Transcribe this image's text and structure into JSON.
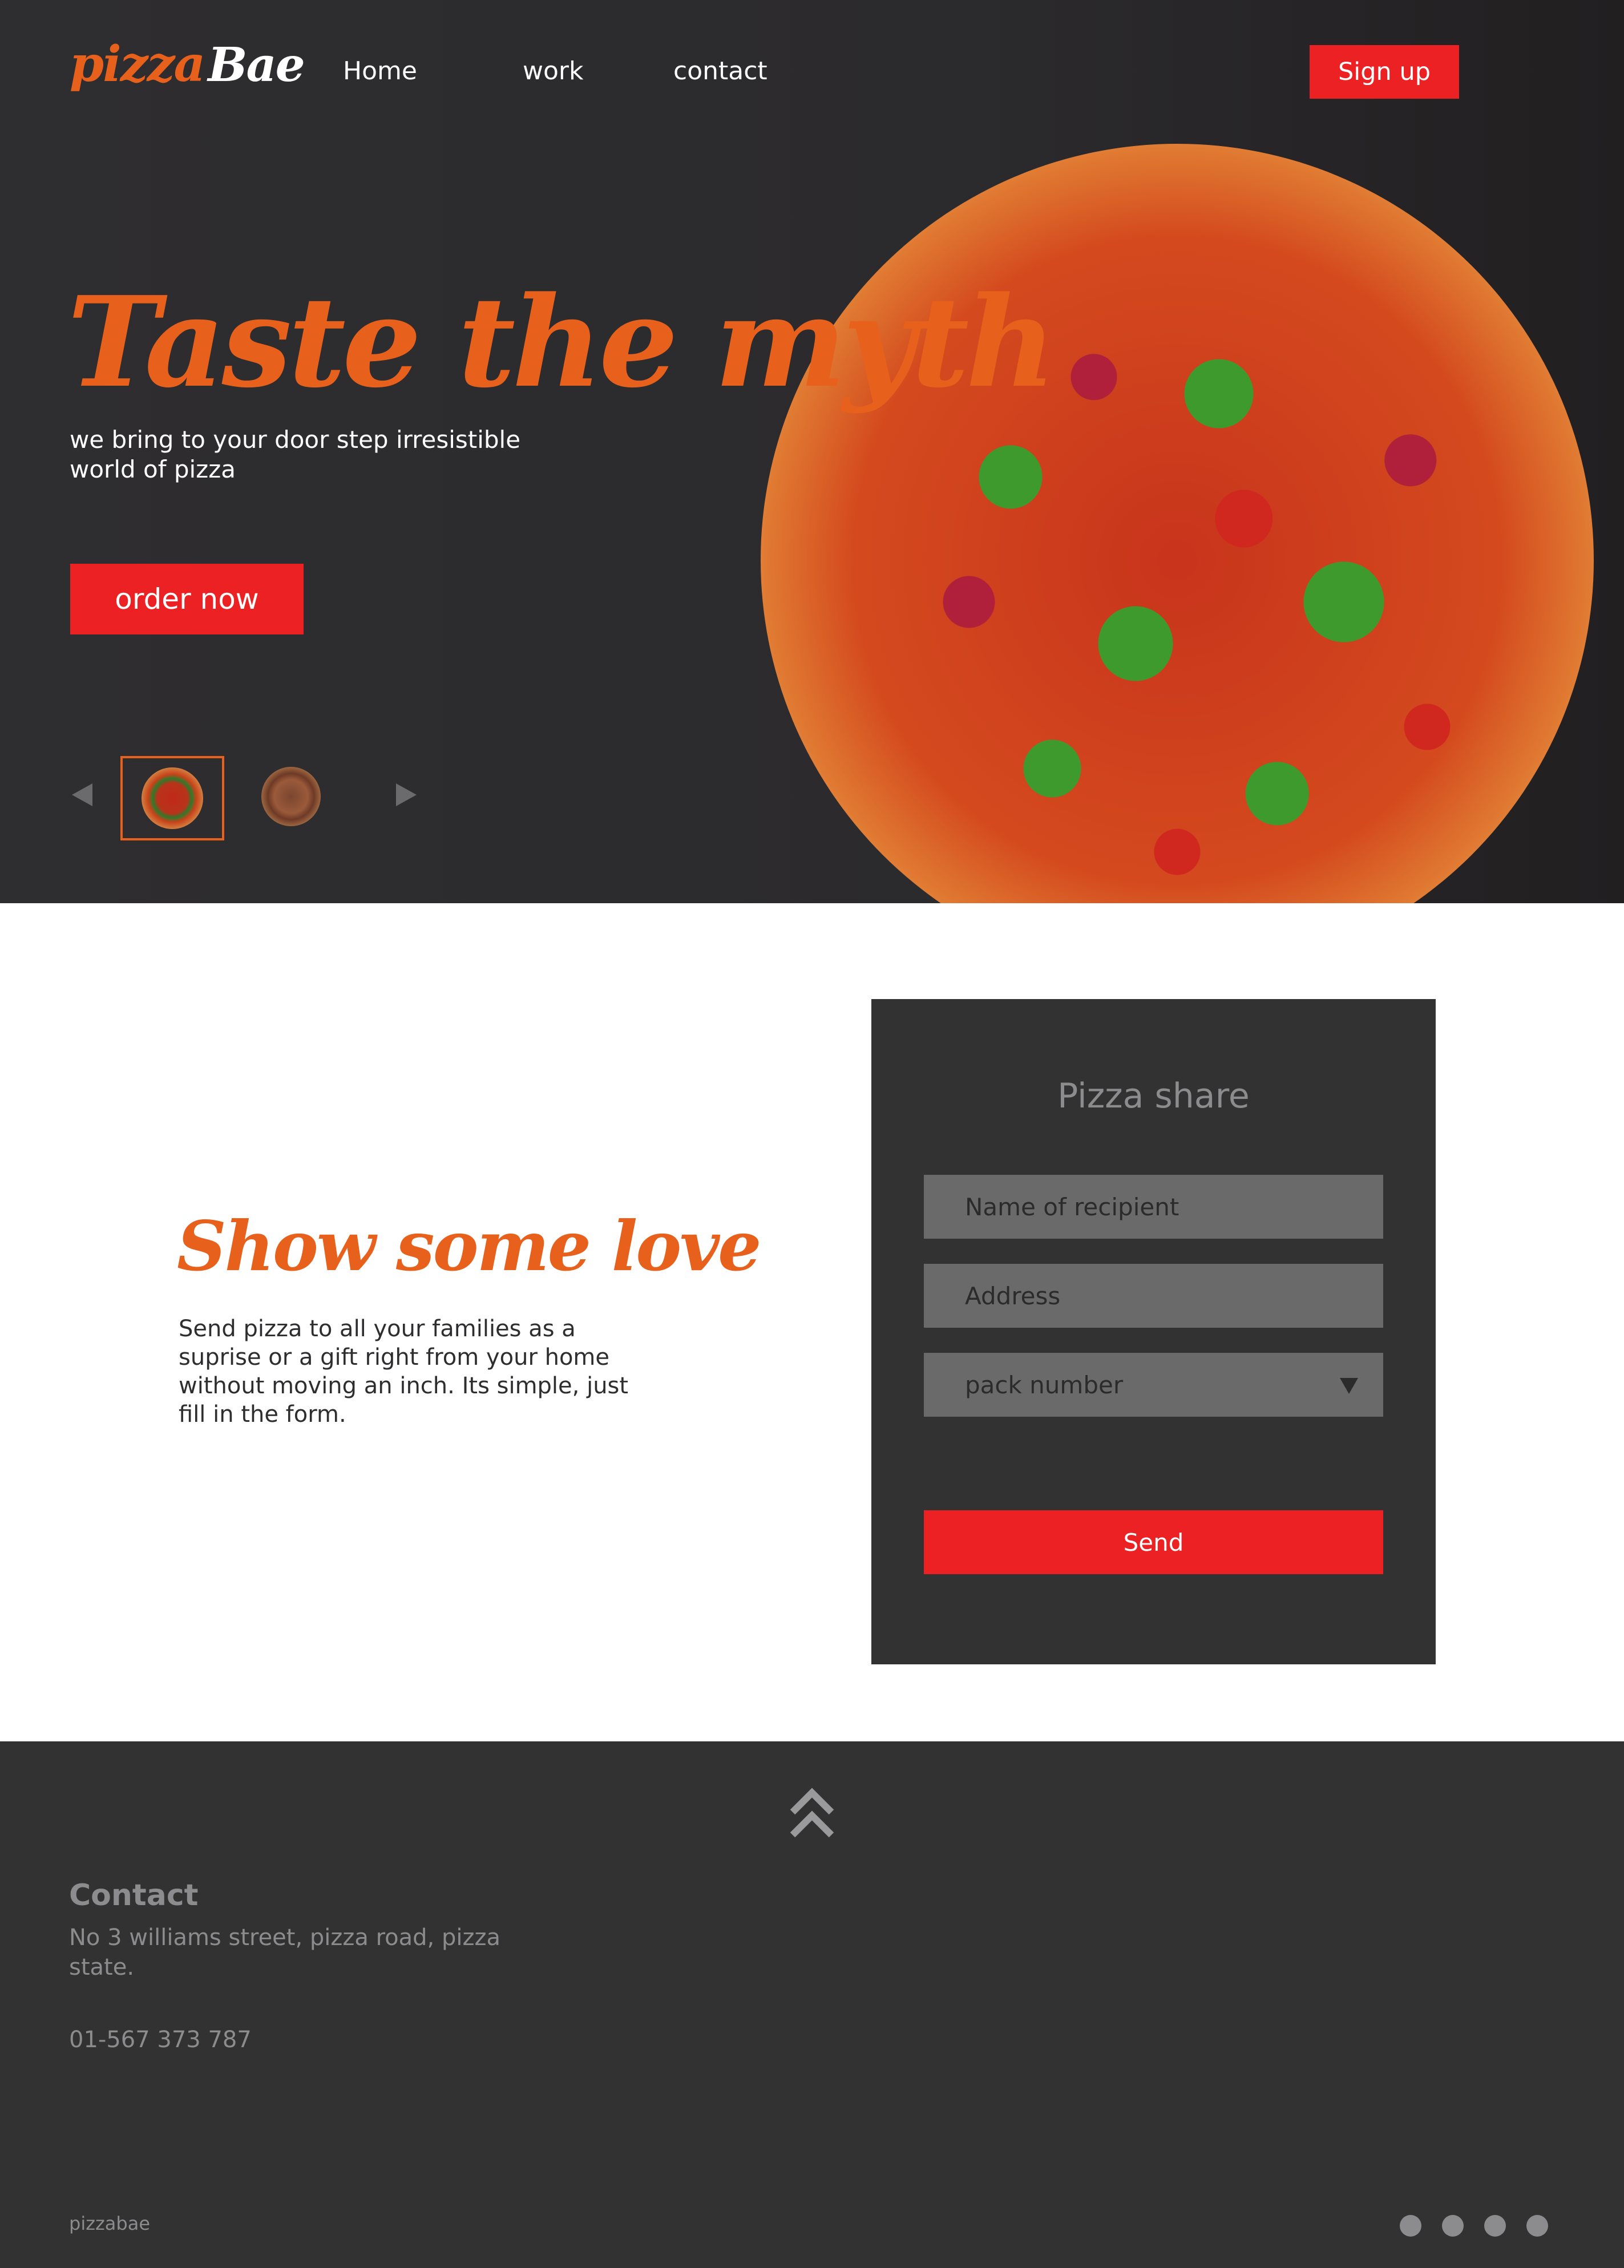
{
  "header": {
    "logo": {
      "part1": "pizza",
      "part2": "Bae"
    },
    "nav": [
      {
        "label": "Home"
      },
      {
        "label": "work"
      },
      {
        "label": "contact"
      }
    ],
    "signup_label": "Sign up"
  },
  "hero": {
    "headline": "Taste the myth",
    "tagline": "we bring to your door step irresistible world of pizza",
    "order_label": "order now",
    "carousel": {
      "slide_count": 2,
      "active_index": 0
    }
  },
  "love": {
    "title": "Show some love",
    "text": "Send pizza to all your families as a suprise or a gift right from your home without moving an inch. Its simple, just fill in the form."
  },
  "form": {
    "title": "Pizza share",
    "name_placeholder": "Name of recipient",
    "address_placeholder": "Address",
    "pack_placeholder": "pack number",
    "send_label": "Send"
  },
  "footer": {
    "contact_heading": "Contact",
    "address": "No 3 williams street, pizza road, pizza state.",
    "phone": "01-567 373 787",
    "brand": "pizzabae",
    "page_dots": 4
  },
  "colors": {
    "accent_orange": "#e8611c",
    "button_red": "#ec2124",
    "dark_bg": "#2e2d2f",
    "panel_bg": "#333233",
    "muted_text": "#8c8b8d"
  },
  "icons": [
    "chevron-left-icon",
    "chevron-right-icon",
    "chevron-double-up-icon",
    "dropdown-arrow-icon"
  ]
}
